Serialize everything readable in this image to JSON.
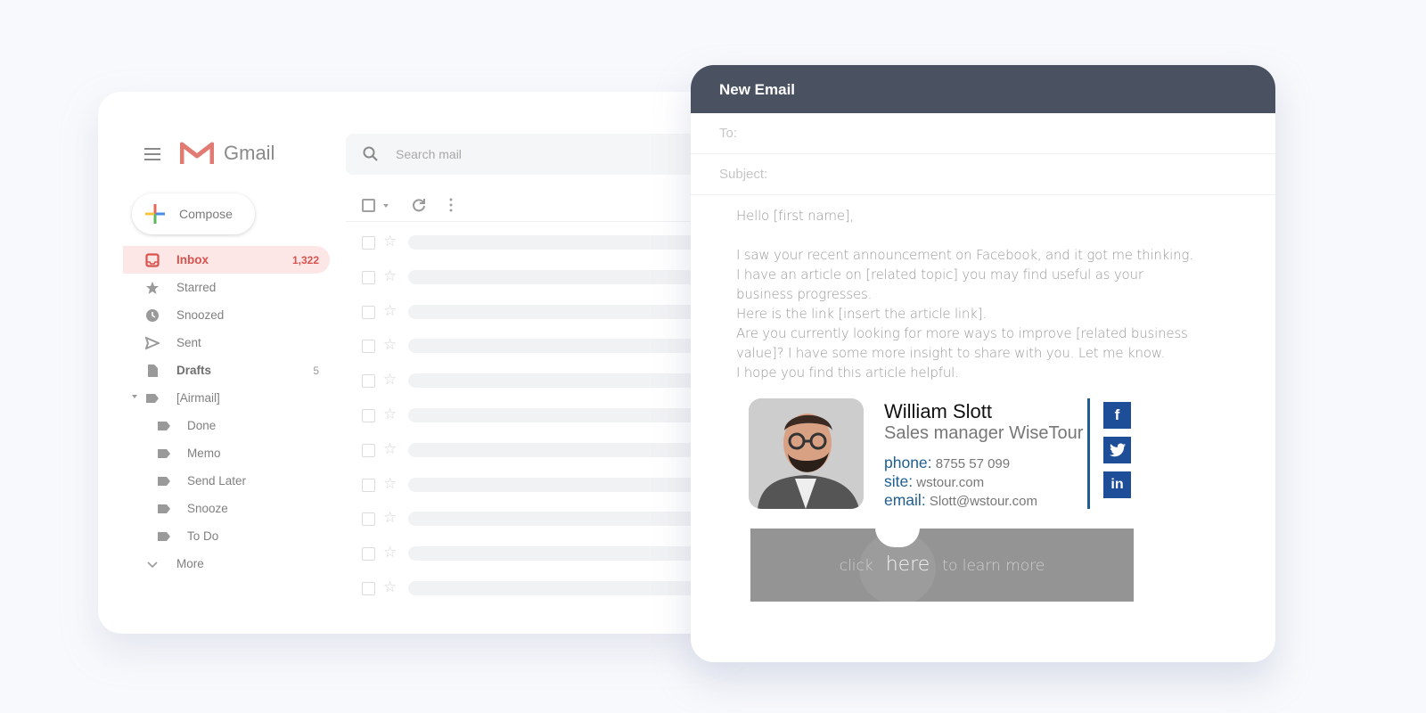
{
  "gmail": {
    "brand": "Gmail",
    "search_placeholder": "Search mail",
    "compose_label": "Compose",
    "nav": [
      {
        "label": "Inbox",
        "count": "1,322",
        "icon": "inbox-icon",
        "active": true
      },
      {
        "label": "Starred",
        "count": "",
        "icon": "star-icon"
      },
      {
        "label": "Snoozed",
        "count": "",
        "icon": "clock-icon"
      },
      {
        "label": "Sent",
        "count": "",
        "icon": "send-icon"
      },
      {
        "label": "Drafts",
        "count": "5",
        "icon": "draft-icon",
        "bold": true
      },
      {
        "label": "[Airmail]",
        "count": "",
        "icon": "label-icon",
        "expandable": true
      },
      {
        "label": "Done",
        "icon": "label-icon",
        "sub": true
      },
      {
        "label": "Memo",
        "icon": "label-icon",
        "sub": true
      },
      {
        "label": "Send Later",
        "icon": "label-icon",
        "sub": true
      },
      {
        "label": "Snooze",
        "icon": "label-icon",
        "sub": true
      },
      {
        "label": "To Do",
        "icon": "label-icon",
        "sub": true
      },
      {
        "label": "More",
        "icon": "chevron-down-icon"
      }
    ],
    "message_rows": 11
  },
  "compose": {
    "title": "New Email",
    "to_label": "To:",
    "to_value": "",
    "subject_label": "Subject:",
    "subject_value": "",
    "body": [
      "Hello [first name],",
      "",
      "I saw your recent announcement on Facebook, and it got me thinking.",
      "I have an article on [related topic] you may find useful as your business progresses.",
      "Here is the link [insert the article link].",
      "Are you currently looking for more ways to improve [related business value]? I have some more insight to share with you. Let me know.",
      "I hope you find this article helpful."
    ],
    "signature": {
      "name": "William Slott",
      "title": "Sales manager WiseTour",
      "phone_label": "phone:",
      "phone": "8755 57 099",
      "site_label": "site:",
      "site": "wstour.com",
      "email_label": "email:",
      "email": "Slott@wstour.com",
      "social": [
        {
          "name": "facebook",
          "glyph": "f"
        },
        {
          "name": "twitter",
          "glyph": "🐦"
        },
        {
          "name": "linkedin",
          "glyph": "in"
        }
      ],
      "accent_color": "#1f5e8f"
    },
    "cta": {
      "before": "click",
      "link": "here",
      "after": "to learn more"
    }
  },
  "colors": {
    "header_bg": "#4a5161",
    "inbox_accent": "#d9534f",
    "social_bg": "#1f4e99"
  }
}
